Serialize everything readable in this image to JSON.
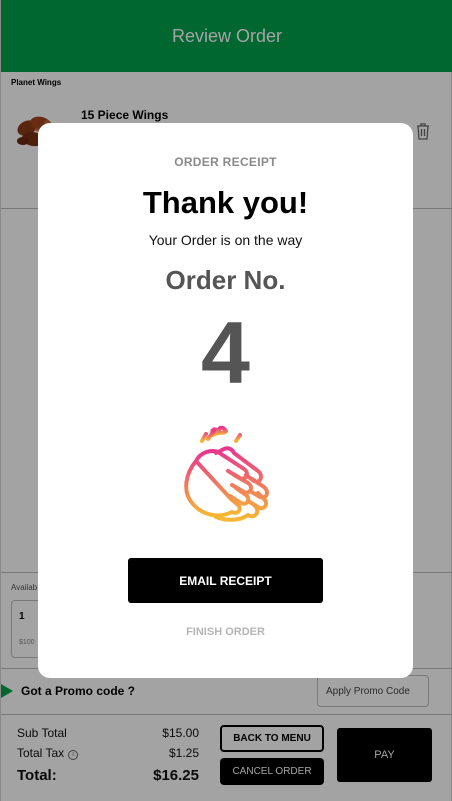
{
  "header": {
    "title": "Review Order"
  },
  "restaurant": {
    "name": "Planet Wings"
  },
  "cart_item": {
    "name": "15 Piece Wings",
    "thumbnail_icon": "chicken-wings-image"
  },
  "availability": {
    "label": "Availab",
    "quantity": "1",
    "sub_text": "$100"
  },
  "promo": {
    "question": "Got a Promo code ?",
    "input_placeholder": "Apply Promo Code"
  },
  "totals": {
    "subtotal_label": "Sub Total",
    "subtotal_value": "$15.00",
    "tax_label": "Total Tax",
    "tax_value": "$1.25",
    "tax_info_glyph": "i",
    "total_label": "Total:",
    "total_value": "$16.25"
  },
  "actions": {
    "back_label": "BACK TO MENU",
    "cancel_label": "CANCEL ORDER",
    "pay_label": "PAY"
  },
  "modal": {
    "eyebrow": "ORDER RECEIPT",
    "heading": "Thank you!",
    "subheading": "Your Order is on the way",
    "order_no_label": "Order No.",
    "order_number": "4",
    "icon": "clapping-hands-icon",
    "email_button": "EMAIL RECEIPT",
    "finish_button": "FINISH ORDER"
  },
  "colors": {
    "brand_green": "#00a14b",
    "button_black": "#000000",
    "gradient_pink": "#e8368f",
    "gradient_orange": "#f7b733"
  }
}
